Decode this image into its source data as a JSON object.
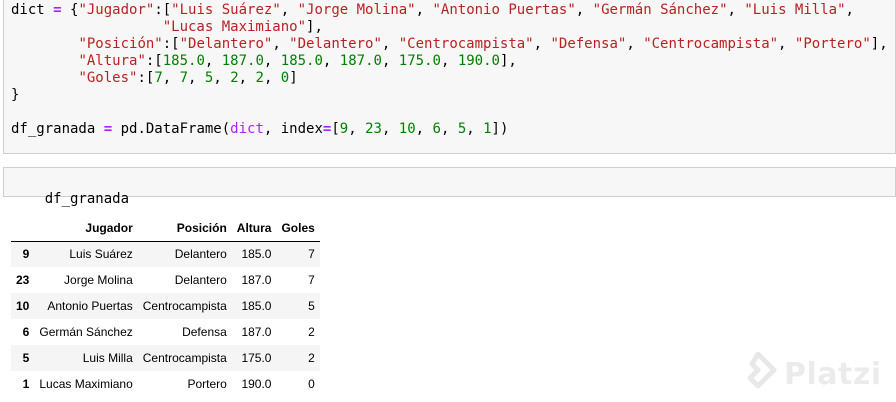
{
  "cell1": {
    "lines": [
      [
        [
          "",
          "dict "
        ],
        [
          "op",
          "="
        ],
        [
          "",
          " {"
        ],
        [
          "str",
          "\"Jugador\""
        ],
        [
          "",
          ":["
        ],
        [
          "str",
          "\"Luis Suárez\""
        ],
        [
          "",
          ", "
        ],
        [
          "str",
          "\"Jorge Molina\""
        ],
        [
          "",
          ", "
        ],
        [
          "str",
          "\"Antonio Puertas\""
        ],
        [
          "",
          ", "
        ],
        [
          "str",
          "\"Germán Sánchez\""
        ],
        [
          "",
          ", "
        ],
        [
          "str",
          "\"Luis Milla\""
        ],
        [
          "",
          ","
        ]
      ],
      [
        [
          "",
          "                  "
        ],
        [
          "str",
          "\"Lucas Maximiano\""
        ],
        [
          "",
          "],"
        ]
      ],
      [
        [
          "",
          "        "
        ],
        [
          "str",
          "\"Posición\""
        ],
        [
          "",
          ":["
        ],
        [
          "str",
          "\"Delantero\""
        ],
        [
          "",
          ", "
        ],
        [
          "str",
          "\"Delantero\""
        ],
        [
          "",
          ", "
        ],
        [
          "str",
          "\"Centrocampista\""
        ],
        [
          "",
          ", "
        ],
        [
          "str",
          "\"Defensa\""
        ],
        [
          "",
          ", "
        ],
        [
          "str",
          "\"Centrocampista\""
        ],
        [
          "",
          ", "
        ],
        [
          "str",
          "\"Portero\""
        ],
        [
          "",
          "],"
        ]
      ],
      [
        [
          "",
          "        "
        ],
        [
          "str",
          "\"Altura\""
        ],
        [
          "",
          ":["
        ],
        [
          "num",
          "185.0"
        ],
        [
          "",
          ", "
        ],
        [
          "num",
          "187.0"
        ],
        [
          "",
          ", "
        ],
        [
          "num",
          "185.0"
        ],
        [
          "",
          ", "
        ],
        [
          "num",
          "187.0"
        ],
        [
          "",
          ", "
        ],
        [
          "num",
          "175.0"
        ],
        [
          "",
          ", "
        ],
        [
          "num",
          "190.0"
        ],
        [
          "",
          "],"
        ]
      ],
      [
        [
          "",
          "        "
        ],
        [
          "str",
          "\"Goles\""
        ],
        [
          "",
          ":["
        ],
        [
          "num",
          "7"
        ],
        [
          "",
          ", "
        ],
        [
          "num",
          "7"
        ],
        [
          "",
          ", "
        ],
        [
          "num",
          "5"
        ],
        [
          "",
          ", "
        ],
        [
          "num",
          "2"
        ],
        [
          "",
          ", "
        ],
        [
          "num",
          "2"
        ],
        [
          "",
          ", "
        ],
        [
          "num",
          "0"
        ],
        [
          "",
          "]"
        ]
      ],
      [
        [
          "",
          "}"
        ]
      ],
      [],
      [
        [
          "",
          "df_granada "
        ],
        [
          "op",
          "="
        ],
        [
          "",
          " pd.DataFrame("
        ],
        [
          "kw",
          "dict"
        ],
        [
          "",
          ", index"
        ],
        [
          "op",
          "="
        ],
        [
          "",
          "["
        ],
        [
          "num",
          "9"
        ],
        [
          "",
          ", "
        ],
        [
          "num",
          "23"
        ],
        [
          "",
          ", "
        ],
        [
          "num",
          "10"
        ],
        [
          "",
          ", "
        ],
        [
          "num",
          "6"
        ],
        [
          "",
          ", "
        ],
        [
          "num",
          "5"
        ],
        [
          "",
          ", "
        ],
        [
          "num",
          "1"
        ],
        [
          "",
          "])"
        ]
      ]
    ]
  },
  "cell2": {
    "code": "df_granada"
  },
  "table": {
    "columns": [
      "",
      "Jugador",
      "Posición",
      "Altura",
      "Goles"
    ],
    "rows": [
      [
        "9",
        "Luis Suárez",
        "Delantero",
        "185.0",
        "7"
      ],
      [
        "23",
        "Jorge Molina",
        "Delantero",
        "187.0",
        "7"
      ],
      [
        "10",
        "Antonio Puertas",
        "Centrocampista",
        "185.0",
        "5"
      ],
      [
        "6",
        "Germán Sánchez",
        "Defensa",
        "187.0",
        "2"
      ],
      [
        "5",
        "Luis Milla",
        "Centrocampista",
        "175.0",
        "2"
      ],
      [
        "1",
        "Lucas Maximiano",
        "Portero",
        "190.0",
        "0"
      ]
    ]
  },
  "watermark": {
    "text": "Platzi",
    "icon": "platzi-logo-icon"
  },
  "colors": {
    "string": "#ba2121",
    "number": "#008000",
    "operator": "#aa22ff",
    "cell_bg": "#f7f7f7"
  }
}
